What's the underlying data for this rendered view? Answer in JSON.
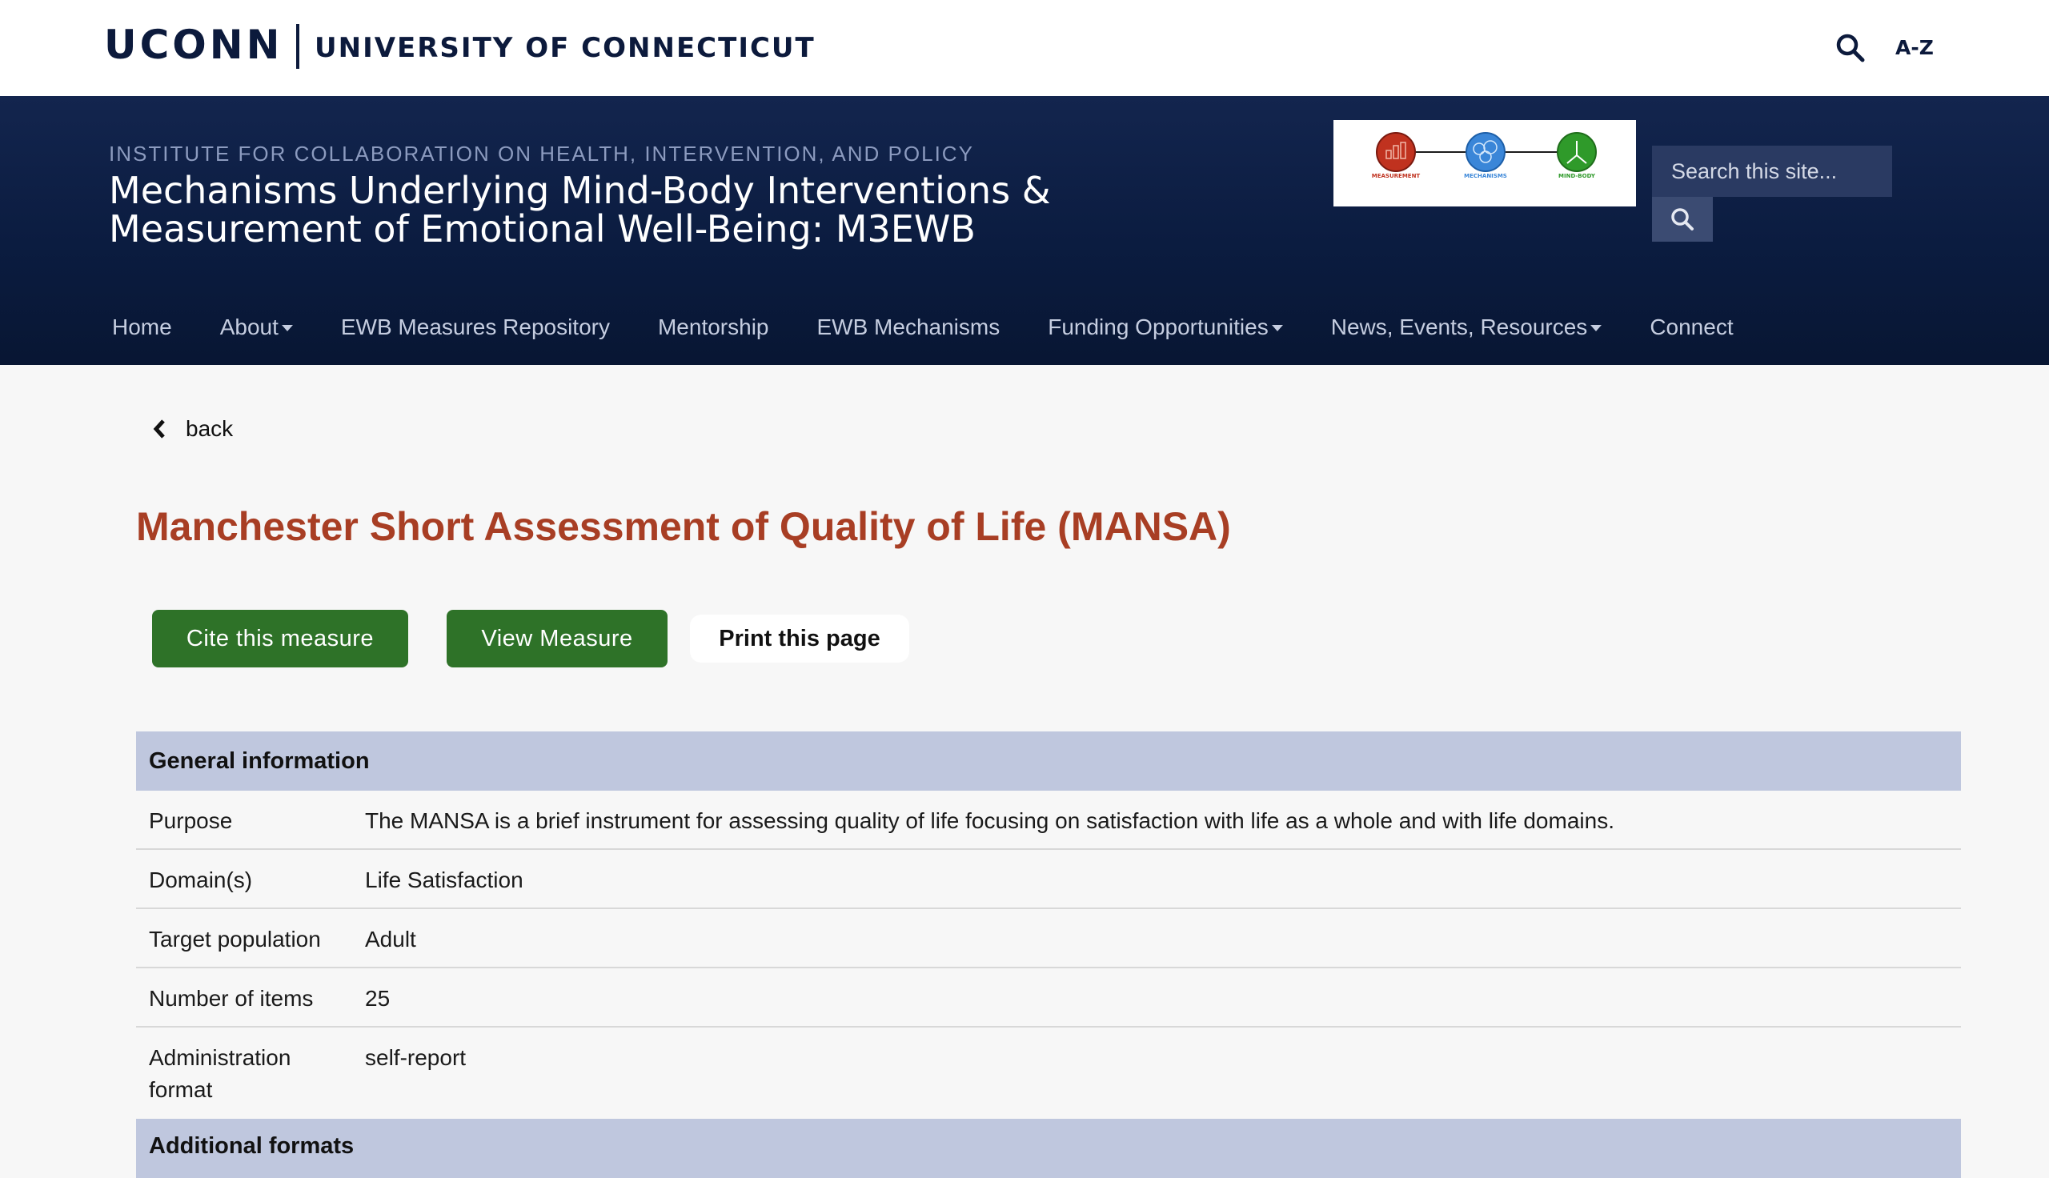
{
  "topbar": {
    "logo": "UCONN",
    "university_name": "UNIVERSITY OF CONNECTICUT",
    "search_icon": "search-icon",
    "az_label": "A-Z"
  },
  "header": {
    "institute": "INSTITUTE FOR COLLABORATION ON HEALTH, INTERVENTION, AND POLICY",
    "title_line1": "Mechanisms Underlying Mind-Body Interventions &",
    "title_line2": "Measurement of Emotional Well-Being: M3EWB",
    "logo": {
      "labels": [
        "MEASUREMENT",
        "MECHANISMS",
        "MIND-BODY"
      ],
      "colors": [
        "#c0321f",
        "#3a86d8",
        "#2f9a2a"
      ]
    },
    "search_placeholder": "Search this site...",
    "search_button_icon": "search-icon"
  },
  "nav": {
    "items": [
      {
        "label": "Home",
        "dropdown": false
      },
      {
        "label": "About",
        "dropdown": true
      },
      {
        "label": "EWB Measures Repository",
        "dropdown": false
      },
      {
        "label": "Mentorship",
        "dropdown": false
      },
      {
        "label": "EWB Mechanisms",
        "dropdown": false
      },
      {
        "label": "Funding Opportunities",
        "dropdown": true
      },
      {
        "label": "News, Events, Resources",
        "dropdown": true
      },
      {
        "label": "Connect",
        "dropdown": false
      }
    ]
  },
  "content": {
    "back_label": "back",
    "title": "Manchester Short Assessment of Quality of Life (MANSA)",
    "buttons": {
      "cite": "Cite this measure",
      "view": "View Measure",
      "print": "Print this page"
    },
    "general_info": {
      "heading": "General information",
      "rows": [
        {
          "label": "Purpose",
          "value": "The MANSA is a brief instrument for assessing quality of life focusing on satisfaction with life as a whole and with life domains."
        },
        {
          "label": "Domain(s)",
          "value": "Life Satisfaction"
        },
        {
          "label": "Target population",
          "value": "Adult"
        },
        {
          "label": "Number of items",
          "value": "25"
        },
        {
          "label": "Administration format",
          "value": "self-report"
        }
      ]
    },
    "additional_formats_heading": "Additional formats"
  },
  "colors": {
    "header_bg": "#0b1c40",
    "title_accent": "#a83e24",
    "button_green": "#2e7228",
    "table_head": "#bfc7de"
  }
}
